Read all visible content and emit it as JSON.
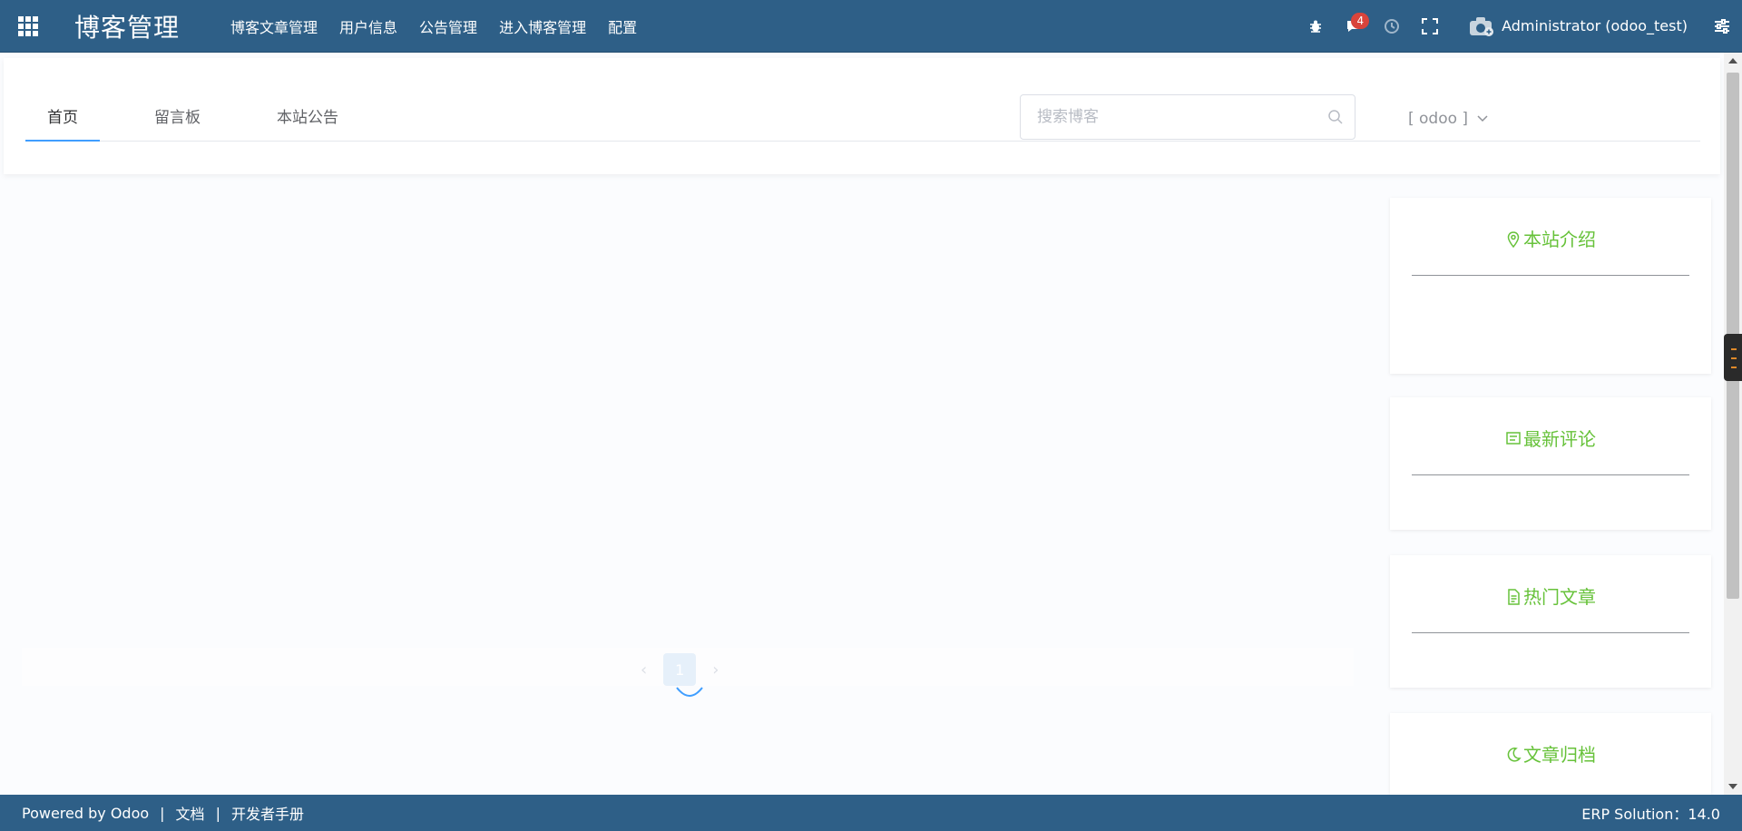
{
  "navbar": {
    "brand": "博客管理",
    "menu": [
      "博客文章管理",
      "用户信息",
      "公告管理",
      "进入博客管理",
      "配置"
    ],
    "messages_badge": "4",
    "user": "Administrator (odoo_test)"
  },
  "tabs": [
    "首页",
    "留言板",
    "本站公告"
  ],
  "search": {
    "placeholder": "搜索博客"
  },
  "user_dropdown": "[  odoo  ]",
  "pagination": {
    "current_page": "1",
    "prev": "‹",
    "next": "›"
  },
  "sidebar": {
    "cards": [
      {
        "title": "本站介绍",
        "icon": "location-pin-icon"
      },
      {
        "title": "最新评论",
        "icon": "comment-box-icon"
      },
      {
        "title": "热门文章",
        "icon": "document-icon"
      },
      {
        "title": "文章归档",
        "icon": "moon-icon"
      }
    ]
  },
  "footer": {
    "powered": "Powered by Odoo",
    "docs": "文档",
    "dev_manual": "开发者手册",
    "version": "ERP Solution：14.0"
  },
  "colors": {
    "navbar": "#2e5f87",
    "accent_green": "#67c23a",
    "tab_active": "#409eff",
    "badge": "#d9443b"
  }
}
